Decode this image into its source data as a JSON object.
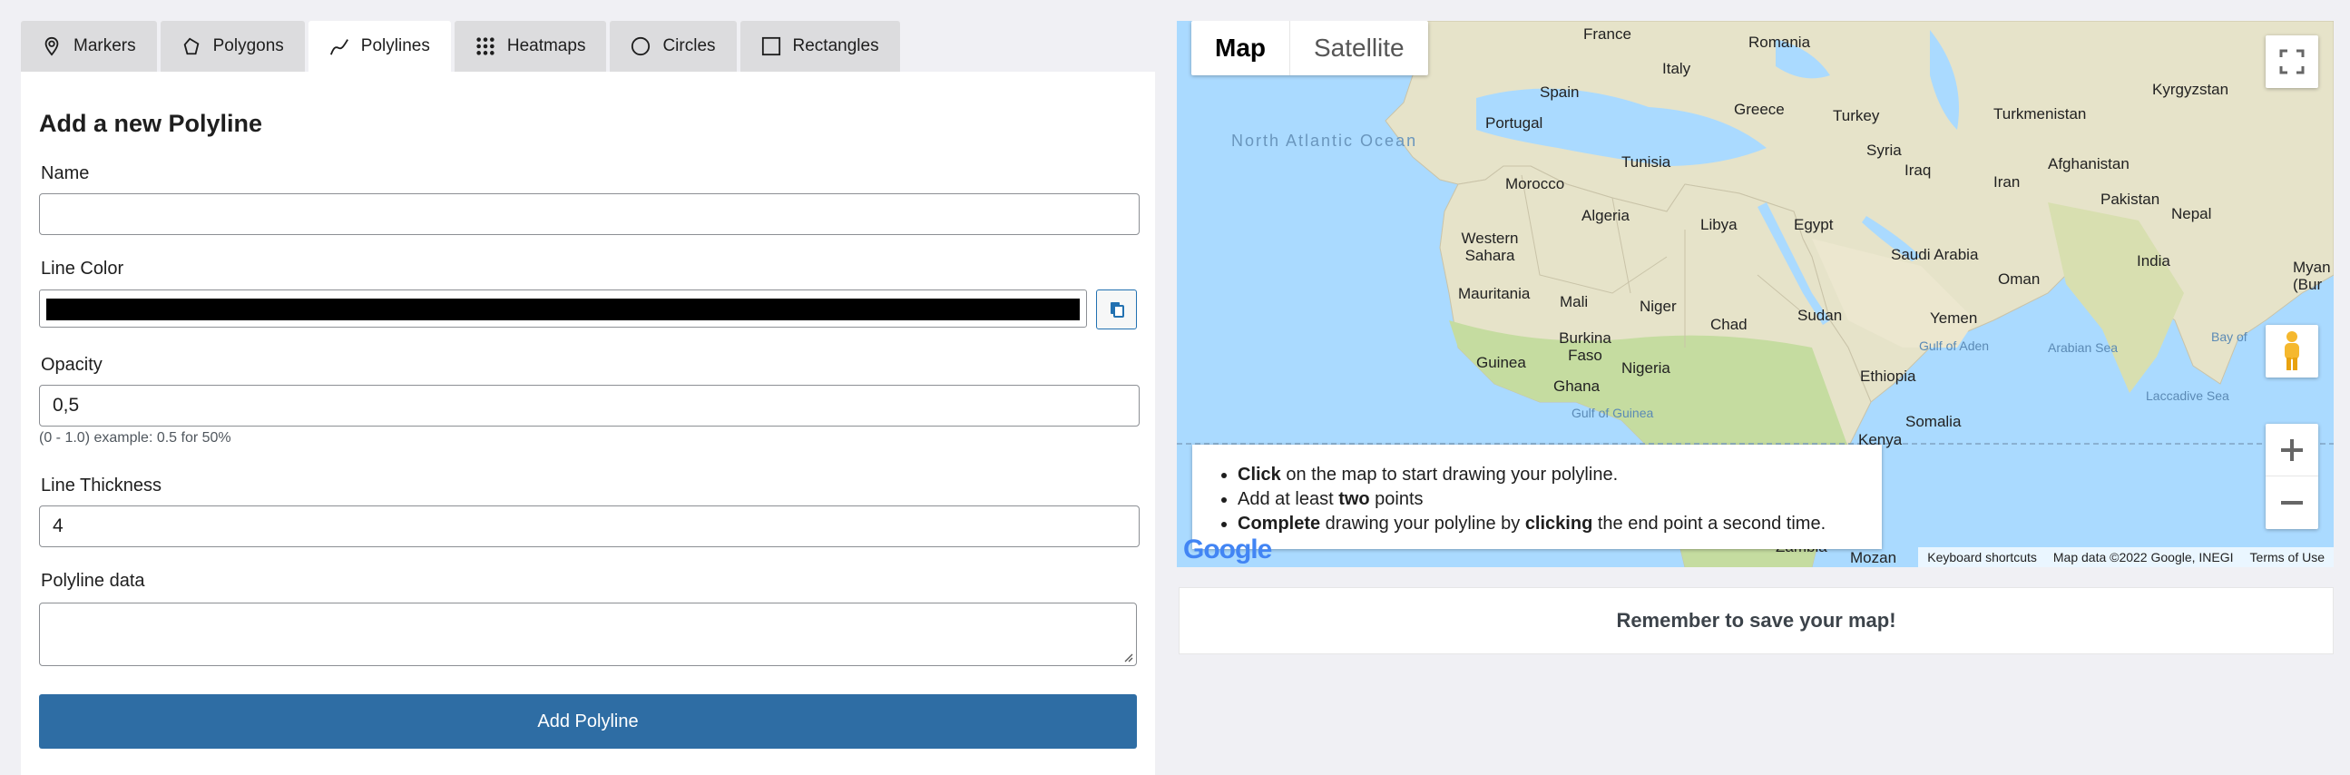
{
  "tabs": [
    {
      "label": "Markers",
      "icon": "marker-icon",
      "active": false
    },
    {
      "label": "Polygons",
      "icon": "polygon-icon",
      "active": false
    },
    {
      "label": "Polylines",
      "icon": "polyline-icon",
      "active": true
    },
    {
      "label": "Heatmaps",
      "icon": "heatmap-icon",
      "active": false
    },
    {
      "label": "Circles",
      "icon": "circle-icon",
      "active": false
    },
    {
      "label": "Rectangles",
      "icon": "rectangle-icon",
      "active": false
    }
  ],
  "form": {
    "title": "Add a new Polyline",
    "name_label": "Name",
    "name_value": "",
    "color_label": "Line Color",
    "color_value": "#000000",
    "opacity_label": "Opacity",
    "opacity_value": "0,5",
    "opacity_hint": "(0 - 1.0) example: 0.5 for 50%",
    "thickness_label": "Line Thickness",
    "thickness_value": "4",
    "data_label": "Polyline data",
    "data_value": "",
    "submit_label": "Add Polyline"
  },
  "map": {
    "type_map": "Map",
    "type_satellite": "Satellite",
    "ocean_label": "North Atlantic Ocean",
    "countries": [
      "France",
      "Romania",
      "Italy",
      "Spain",
      "Greece",
      "Turkey",
      "Turkmenistan",
      "Kyrgyzstan",
      "Portugal",
      "Tunisia",
      "Syria",
      "Iraq",
      "Iran",
      "Afghanistan",
      "Morocco",
      "Pakistan",
      "Algeria",
      "Libya",
      "Egypt",
      "Nepal",
      "Western Sahara",
      "Saudi Arabia",
      "Oman",
      "India",
      "Myan (Bur",
      "Mauritania",
      "Mali",
      "Niger",
      "Chad",
      "Sudan",
      "Yemen",
      "Burkina Faso",
      "Guinea",
      "Nigeria",
      "Ethiopia",
      "Ghana",
      "Kenya",
      "Somalia",
      "Zambia",
      "Mozan"
    ],
    "waters": [
      "Gulf of Aden",
      "Arabian Sea",
      "Bay of",
      "Gulf of Guinea",
      "Laccadive Sea"
    ],
    "instructions": {
      "l1_b": "Click",
      "l1_t": " on the map to start drawing your polyline.",
      "l2_t": "Add at least ",
      "l2_b": "two",
      "l2_t2": " points",
      "l3_b": "Complete",
      "l3_t": " drawing your polyline by ",
      "l3_b2": "clicking",
      "l3_t2": " the end point a second time."
    },
    "attribution": {
      "shortcuts": "Keyboard shortcuts",
      "data": "Map data ©2022 Google, INEGI",
      "terms": "Terms of Use"
    },
    "logo": "Google"
  },
  "footer": {
    "save_reminder": "Remember to save your map!"
  },
  "colors": {
    "primary": "#2e6da4",
    "water": "#aadaff",
    "land": "#e6e3c9",
    "vegetation": "#c5dca0"
  }
}
